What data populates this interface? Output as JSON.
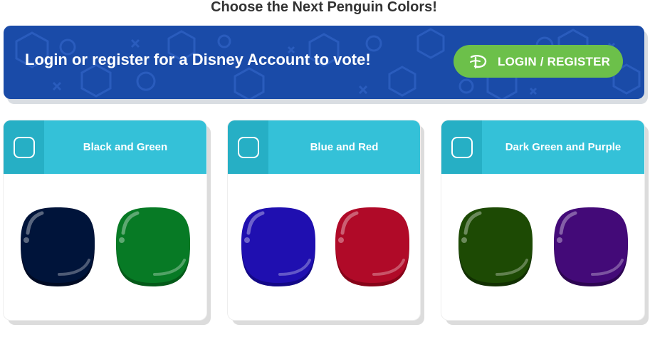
{
  "page": {
    "title": "Choose the Next Penguin Colors!"
  },
  "banner": {
    "message": "Login or register for a Disney Account to vote!",
    "button_label": "LOGIN / REGISTER",
    "button_icon": "disney-d-icon",
    "colors": {
      "background": "#1a4ba8",
      "button": "#6cc04a"
    }
  },
  "options": [
    {
      "label": "Black and Green",
      "selected": false,
      "swatches": [
        {
          "name": "Black",
          "color": "#00143a",
          "shade": "#000b24"
        },
        {
          "name": "Green",
          "color": "#077a25",
          "shade": "#045a19"
        }
      ]
    },
    {
      "label": "Blue and Red",
      "selected": false,
      "swatches": [
        {
          "name": "Blue",
          "color": "#1f0fb0",
          "shade": "#130887"
        },
        {
          "name": "Red",
          "color": "#b00a28",
          "shade": "#870419"
        }
      ]
    },
    {
      "label": "Dark Green and Purple",
      "selected": false,
      "swatches": [
        {
          "name": "Dark Green",
          "color": "#1d4a04",
          "shade": "#123002"
        },
        {
          "name": "Purple",
          "color": "#430a78",
          "shade": "#2d0552"
        }
      ]
    }
  ],
  "colors": {
    "card_header": "#34c1d8",
    "checkbox_cell": "#26afc5",
    "title_text": "#333333"
  }
}
